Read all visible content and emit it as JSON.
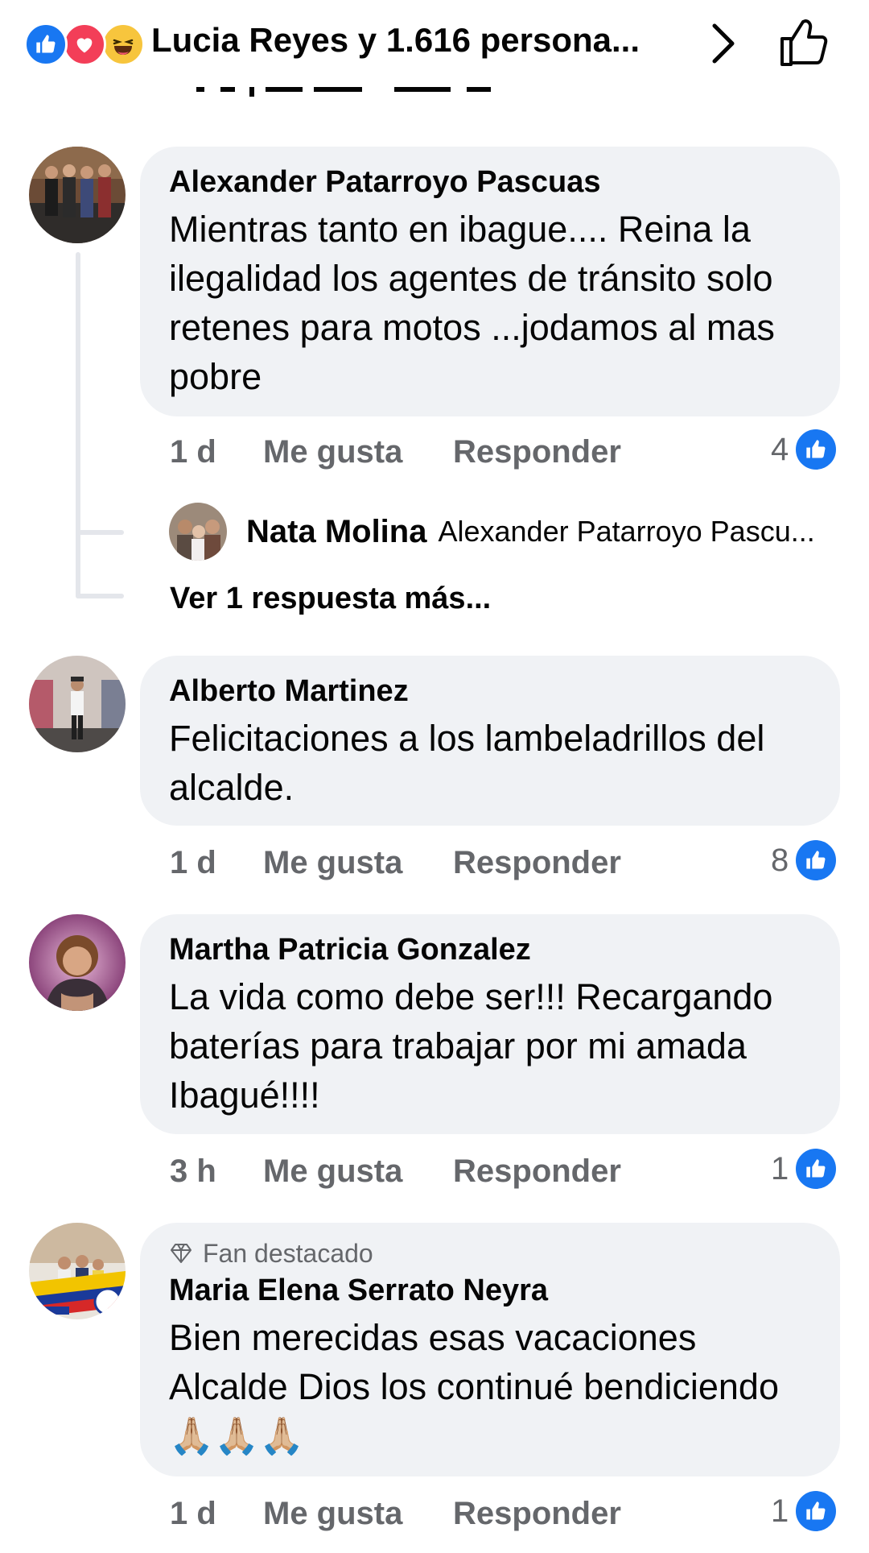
{
  "header": {
    "reactions_text": "Lucia Reyes y 1.616 persona...",
    "reaction_icons": [
      "like-icon",
      "love-icon",
      "haha-icon"
    ],
    "chevron_icon": "chevron-right-icon",
    "like_icon": "thumbs-up-outline-icon"
  },
  "colors": {
    "facebook_blue": "#1877f2",
    "love_red": "#f33e58",
    "haha_yellow": "#f7c53d",
    "bubble_bg": "#f0f2f5",
    "meta_gray": "#65676b"
  },
  "comments": [
    {
      "author": "Alexander Patarroyo Pascuas",
      "text": "Mientras tanto en ibague.... Reina la ilegalidad los agentes de tránsito solo retenes para motos ...jodamos al mas pobre",
      "time": "1 d",
      "like_label": "Me gusta",
      "reply_label": "Responder",
      "reaction_count": "4",
      "replies": {
        "reply_author": "Nata Molina",
        "reply_preview": "Alexander Patarroyo Pascu...",
        "more_label": "Ver 1 respuesta más..."
      }
    },
    {
      "author": "Alberto Martinez",
      "text": "Felicitaciones a los lambeladrillos del alcalde.",
      "time": "1 d",
      "like_label": "Me gusta",
      "reply_label": "Responder",
      "reaction_count": "8"
    },
    {
      "author": "Martha Patricia Gonzalez",
      "text": "La vida como debe ser!!! Recargando baterías para trabajar por mi amada Ibagué!!!!",
      "time": "3 h",
      "like_label": "Me gusta",
      "reply_label": "Responder",
      "reaction_count": "1"
    },
    {
      "badge": "Fan destacado",
      "author": "Maria Elena Serrato Neyra",
      "text": "Bien merecidas esas vacaciones Alcalde Dios los continué bendiciendo 🙏🏼🙏🏼🙏🏼",
      "time": "1 d",
      "like_label": "Me gusta",
      "reply_label": "Responder",
      "reaction_count": "1"
    }
  ]
}
